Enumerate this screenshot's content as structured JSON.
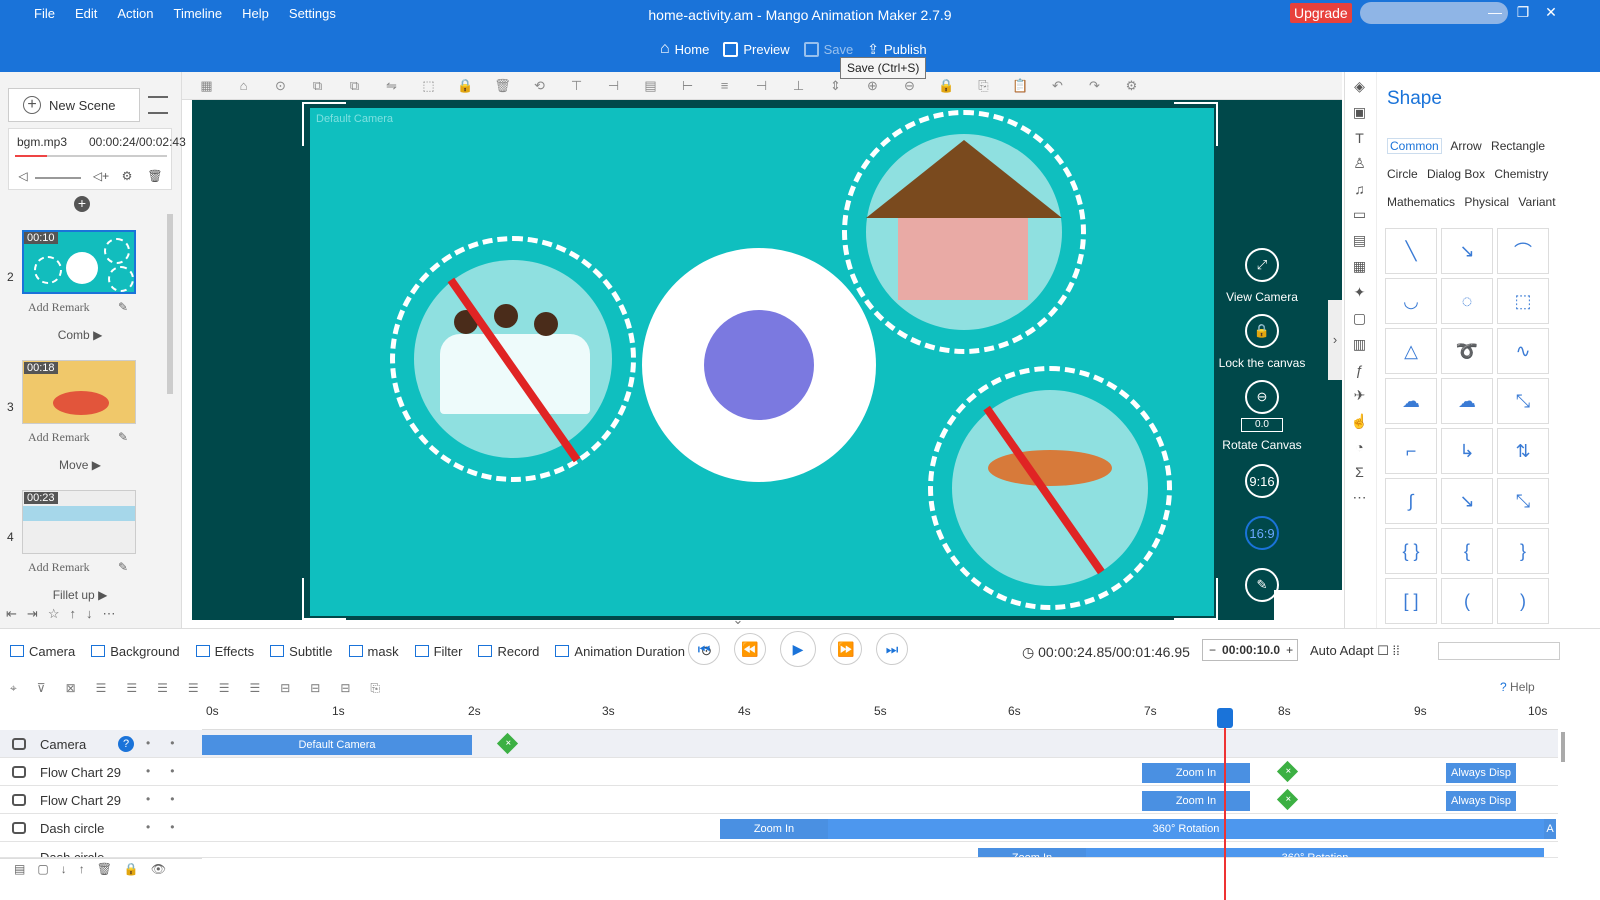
{
  "menu": [
    "File",
    "Edit",
    "Action",
    "Timeline",
    "Help",
    "Settings"
  ],
  "window_title": "home-activity.am - Mango Animation Maker 2.7.9",
  "upgrade_label": "Upgrade",
  "window_controls": {
    "minimize": "—",
    "restore": "❐",
    "close": "✕"
  },
  "topnav": {
    "home": "Home",
    "preview": "Preview",
    "save": "Save",
    "publish": "Publish"
  },
  "tooltip": "Save (Ctrl+S)",
  "left": {
    "new_scene": "New Scene",
    "audio": {
      "name": "bgm.mp3",
      "time": "00:00:24/00:02:43"
    },
    "scenes": [
      {
        "num": "2",
        "time": "00:10",
        "remark": "Add Remark",
        "transition": "Comb"
      },
      {
        "num": "3",
        "time": "00:18",
        "remark": "Add Remark",
        "transition": "Move"
      },
      {
        "num": "4",
        "time": "00:23",
        "remark": "Add Remark",
        "transition": "Fillet up"
      }
    ]
  },
  "canvas": {
    "camera_label": "Default Camera",
    "controls": {
      "view_camera": "View Camera",
      "lock_canvas": "Lock the canvas",
      "rotate_value": "0.0",
      "rotate_canvas": "Rotate Canvas",
      "ratio_916": "9:16",
      "ratio_169": "16:9"
    }
  },
  "shape_panel": {
    "title": "Shape",
    "categories": [
      "Common",
      "Arrow",
      "Rectangle",
      "Circle",
      "Dialog Box",
      "Chemistry",
      "Mathematics",
      "Physical",
      "Variant"
    ],
    "active_category": "Common"
  },
  "timeline": {
    "tools": [
      "Camera",
      "Background",
      "Effects",
      "Subtitle",
      "mask",
      "Filter",
      "Record",
      "Animation Duration"
    ],
    "time_readout": "00:00:24.85/00:01:46.95",
    "duration_value": "00:00:10.0",
    "auto_adapt": "Auto Adapt",
    "help": "Help",
    "ruler": [
      "0s",
      "1s",
      "2s",
      "3s",
      "4s",
      "5s",
      "6s",
      "7s",
      "8s",
      "9s",
      "10s"
    ],
    "tracks": [
      {
        "name": "Camera",
        "clips": [
          {
            "label": "Default Camera"
          }
        ]
      },
      {
        "name": "Flow Chart 29",
        "clips": [
          {
            "label": "Zoom In"
          },
          {
            "label": "Always Disp"
          }
        ]
      },
      {
        "name": "Flow Chart 29",
        "clips": [
          {
            "label": "Zoom In"
          },
          {
            "label": "Always Disp"
          }
        ]
      },
      {
        "name": "Dash circle",
        "clips": [
          {
            "label": "Zoom In"
          },
          {
            "label": "360° Rotation"
          },
          {
            "label": "A"
          }
        ]
      },
      {
        "name": "Dash circle",
        "clips": [
          {
            "label": "Zoom In"
          },
          {
            "label": "360° Rotation"
          }
        ]
      }
    ]
  },
  "colors": {
    "accent": "#1a73d9",
    "stage": "#0fbfbf",
    "canvas_bg": "#00484a",
    "clip": "#4a90e2"
  }
}
